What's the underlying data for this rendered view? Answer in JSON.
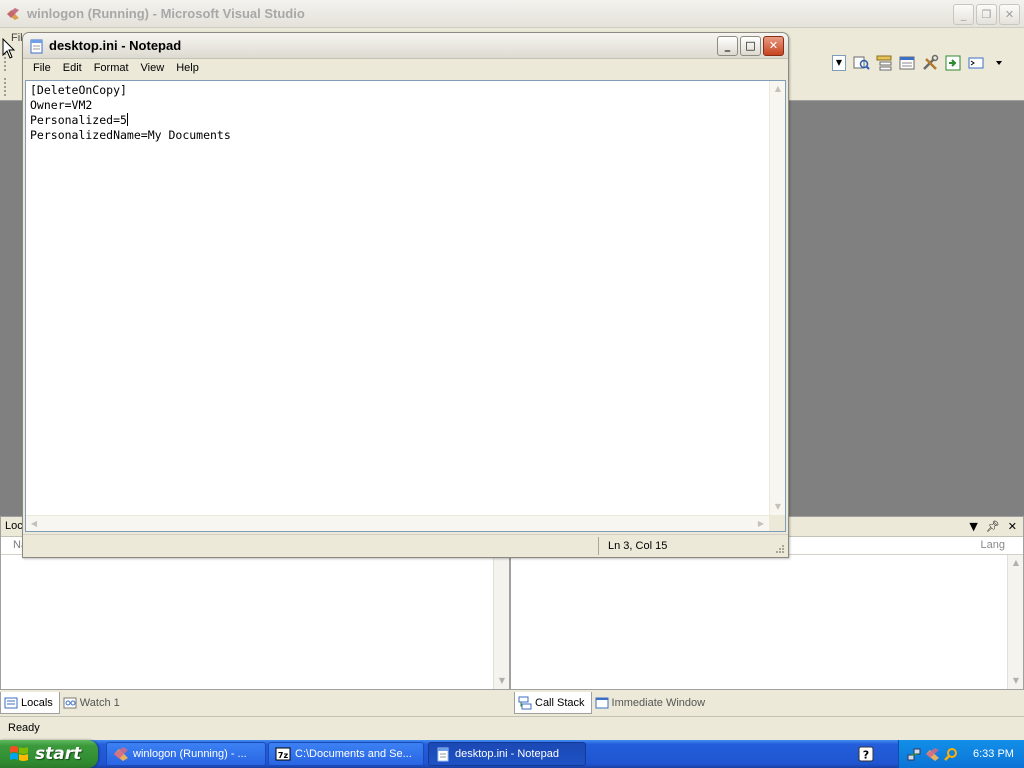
{
  "vs": {
    "title": "winlogon (Running) - Microsoft Visual Studio",
    "menu_stub": "Fil",
    "status": "Ready",
    "left_panel_header_stub": "Loca",
    "left_panel_column_stub": "Na",
    "right_panel_column_stub": "Lang",
    "left_tabs": [
      {
        "label": "Locals",
        "icon": "locals-icon",
        "active": true
      },
      {
        "label": "Watch 1",
        "icon": "watch-icon",
        "active": false
      }
    ],
    "right_tabs": [
      {
        "label": "Call Stack",
        "icon": "call-stack-icon",
        "active": true
      },
      {
        "label": "Immediate Window",
        "icon": "immediate-window-icon",
        "active": false
      }
    ]
  },
  "notepad": {
    "title": "desktop.ini - Notepad",
    "menu": [
      "File",
      "Edit",
      "Format",
      "View",
      "Help"
    ],
    "lines": [
      "[DeleteOnCopy]",
      "Owner=VM2",
      "Personalized=5",
      "PersonalizedName=My Documents"
    ],
    "caret_line": 3,
    "status": "Ln 3, Col 15"
  },
  "taskbar": {
    "start_label": "start",
    "buttons": [
      {
        "label": "winlogon (Running) - ...",
        "icon": "visual-studio-icon",
        "active": false
      },
      {
        "label": "C:\\Documents and Se...",
        "icon": "7zip-icon",
        "active": false
      },
      {
        "label": "desktop.ini - Notepad",
        "icon": "notepad-icon",
        "active": true
      }
    ],
    "clock": "6:33 PM"
  },
  "colors": {
    "taskbar_blue": "#245edb",
    "start_green": "#3c9a3c",
    "vs_editor_gray": "#808080",
    "close_red": "#c6431f"
  }
}
